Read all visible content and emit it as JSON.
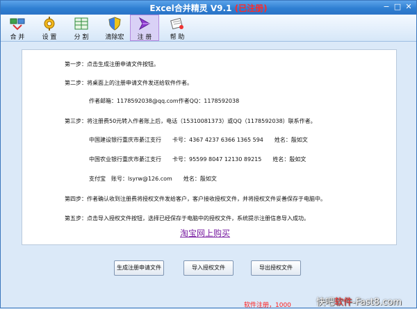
{
  "window": {
    "title_main": "Excel合并精灵 V9.1",
    "title_status": "(已注册)",
    "controls": {
      "minimize": "−",
      "maximize": "□",
      "close": "✕"
    }
  },
  "toolbar": [
    {
      "label": "合 并",
      "icon": "merge-icon"
    },
    {
      "label": "设 置",
      "icon": "settings-gear-icon"
    },
    {
      "label": "分 割",
      "icon": "split-table-icon"
    },
    {
      "label": "清除宏",
      "icon": "shield-icon"
    },
    {
      "label": "注 册",
      "icon": "register-icon"
    },
    {
      "label": "帮 助",
      "icon": "help-icon"
    }
  ],
  "steps": {
    "s1": "第一步：点击生成注册申请文件按钮。",
    "s2": "第二步：将桌面上的注册申请文件发送给软件作者。",
    "email": "作者邮箱：1178592038@qq.com作者QQ：1178592038",
    "s3": "第三步：将注册费50元转入作者账上后，电话（15310081373）或QQ（1178592038）联系作者。",
    "bank1": "中国建设银行重庆市綦江支行　　卡号：4367 4237 6366 1365 594　　姓名：殷如文",
    "bank2": "中国农业银行重庆市綦江支行　　卡号：95599 8047 12130 89215　　姓名：殷如文",
    "alipay": "支付宝　账号：lsyrw@126.com　　姓名：殷如文",
    "s4": "第四步：作者确认收到注册费将授权文件发给客户，客户接收授权文件，并将授权文件妥善保存于电脑中。",
    "s5": "第五步：点击导入授权文件按钮，选择已经保存于电脑中的授权文件，系统提示注册信息导入成功。"
  },
  "link_text": "淘宝网上购买",
  "buttons": {
    "generate": "生成注册申请文件",
    "import": "导入授权文件",
    "export": "导出授权文件"
  },
  "footer_text": "软件注册，1000",
  "watermark": {
    "part1": "快吧",
    "part2": "软件",
    "part3": "-Fast8.com"
  },
  "colors": {
    "titlebar": "#2f7fd2",
    "accent_red": "#ff2a2a",
    "link": "#7a1fa2"
  }
}
